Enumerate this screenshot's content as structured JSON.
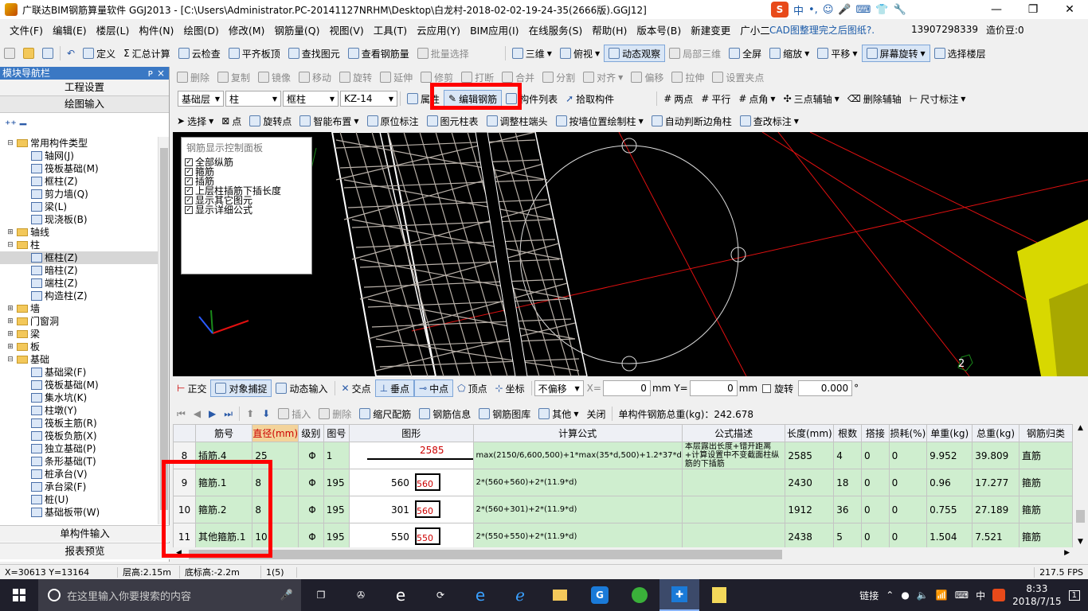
{
  "window": {
    "title": "广联达BIM钢筋算量软件 GGJ2013 - [C:\\Users\\Administrator.PC-20141127NRHM\\Desktop\\白龙村-2018-02-02-19-24-35(2666版).GGJ12]",
    "minimize": "—",
    "restore": "❐",
    "close": "✕"
  },
  "ime": {
    "brand": "S",
    "lang": "中",
    "punct": "•,",
    "emoji": "☺",
    "mic": "🎤",
    "keyboard": "⌨",
    "shirt": "👕",
    "tools": "🔧"
  },
  "menu": {
    "items": [
      "文件(F)",
      "编辑(E)",
      "楼层(L)",
      "构件(N)",
      "绘图(D)",
      "修改(M)",
      "钢筋量(Q)",
      "视图(V)",
      "工具(T)",
      "云应用(Y)",
      "BIM应用(I)",
      "在线服务(S)",
      "帮助(H)",
      "版本号(B)",
      "新建变更",
      "广小二"
    ],
    "cad_note": "CAD图整理完之后图纸?.",
    "phone": "13907298339",
    "cost_bean": "造价豆:0"
  },
  "toolbar1": {
    "define": "定义",
    "sum": "汇总计算",
    "cloud_check": "云检查",
    "flat_top": "平齐板顶",
    "find": "查找图元",
    "view_rebar": "查看钢筋量",
    "batch_select": "批量选择",
    "three_d": "三维",
    "top_view": "俯视",
    "dynamic": "动态观察",
    "local_3d": "局部三维",
    "fullscreen": "全屏",
    "zoom": "缩放",
    "pan": "平移",
    "rotate": "屏幕旋转",
    "select_floor": "选择楼层"
  },
  "toolbar2": {
    "delete": "删除",
    "copy": "复制",
    "mirror": "镜像",
    "move": "移动",
    "rotate": "旋转",
    "extend": "延伸",
    "trim": "修剪",
    "break": "打断",
    "merge": "合并",
    "split": "分割",
    "align": "对齐",
    "offset": "偏移",
    "stretch": "拉伸",
    "set_point": "设置夹点"
  },
  "toolbar3": {
    "floor": "基础层",
    "type": "柱",
    "subtype": "框柱",
    "component": "KZ-14",
    "property": "属性",
    "edit_rebar": "编辑钢筋",
    "comp_list": "构件列表",
    "pick": "拾取构件",
    "two_point": "两点",
    "parallel": "平行",
    "point_angle": "点角",
    "three_point_aux": "三点辅轴",
    "del_aux": "删除辅轴",
    "dim": "尺寸标注"
  },
  "toolbar4": {
    "select": "选择",
    "point": "点",
    "rotate_point": "旋转点",
    "smart_layout": "智能布置",
    "inplace_mark": "原位标注",
    "col_table": "图元柱表",
    "adjust_end": "调整柱端头",
    "draw_by_wall": "按墙位置绘制柱",
    "auto_corner": "自动判断边角柱",
    "check_mark": "查改标注"
  },
  "nav": {
    "title": "模块导航栏",
    "pin": "ᴘ",
    "close": "×",
    "project_settings": "工程设置",
    "drawing_input": "绘图输入",
    "single_input": "单构件输入",
    "report": "报表预览",
    "tree": [
      {
        "label": "常用构件类型",
        "level": 0,
        "type": "folder",
        "exp": "⊟"
      },
      {
        "label": "轴网(J)",
        "level": 1,
        "type": "leaf"
      },
      {
        "label": "筏板基础(M)",
        "level": 1,
        "type": "leaf"
      },
      {
        "label": "框柱(Z)",
        "level": 1,
        "type": "leaf"
      },
      {
        "label": "剪力墙(Q)",
        "level": 1,
        "type": "leaf"
      },
      {
        "label": "梁(L)",
        "level": 1,
        "type": "leaf"
      },
      {
        "label": "现浇板(B)",
        "level": 1,
        "type": "leaf"
      },
      {
        "label": "轴线",
        "level": 0,
        "type": "folder",
        "exp": "⊞"
      },
      {
        "label": "柱",
        "level": 0,
        "type": "folder",
        "exp": "⊟"
      },
      {
        "label": "框柱(Z)",
        "level": 1,
        "type": "leaf",
        "selected": true
      },
      {
        "label": "暗柱(Z)",
        "level": 1,
        "type": "leaf"
      },
      {
        "label": "端柱(Z)",
        "level": 1,
        "type": "leaf"
      },
      {
        "label": "构造柱(Z)",
        "level": 1,
        "type": "leaf"
      },
      {
        "label": "墙",
        "level": 0,
        "type": "folder",
        "exp": "⊞"
      },
      {
        "label": "门窗洞",
        "level": 0,
        "type": "folder",
        "exp": "⊞"
      },
      {
        "label": "梁",
        "level": 0,
        "type": "folder",
        "exp": "⊞"
      },
      {
        "label": "板",
        "level": 0,
        "type": "folder",
        "exp": "⊞"
      },
      {
        "label": "基础",
        "level": 0,
        "type": "folder",
        "exp": "⊟"
      },
      {
        "label": "基础梁(F)",
        "level": 1,
        "type": "leaf"
      },
      {
        "label": "筏板基础(M)",
        "level": 1,
        "type": "leaf"
      },
      {
        "label": "集水坑(K)",
        "level": 1,
        "type": "leaf"
      },
      {
        "label": "柱墩(Y)",
        "level": 1,
        "type": "leaf"
      },
      {
        "label": "筏板主筋(R)",
        "level": 1,
        "type": "leaf"
      },
      {
        "label": "筏板负筋(X)",
        "level": 1,
        "type": "leaf"
      },
      {
        "label": "独立基础(P)",
        "level": 1,
        "type": "leaf"
      },
      {
        "label": "条形基础(T)",
        "level": 1,
        "type": "leaf"
      },
      {
        "label": "桩承台(V)",
        "level": 1,
        "type": "leaf"
      },
      {
        "label": "承台梁(F)",
        "level": 1,
        "type": "leaf"
      },
      {
        "label": "桩(U)",
        "level": 1,
        "type": "leaf"
      },
      {
        "label": "基础板带(W)",
        "level": 1,
        "type": "leaf"
      }
    ]
  },
  "control_panel": {
    "title": "钢筋显示控制面板",
    "options": [
      "全部纵筋",
      "箍筋",
      "插筋",
      "上层柱插筋下插长度",
      "显示其它图元",
      "显示详细公式"
    ]
  },
  "viewport": {
    "badge": "2"
  },
  "snapbar": {
    "ortho": "正交",
    "osnap": "对象捕捉",
    "dyn_input": "动态输入",
    "intersect": "交点",
    "perp": "垂点",
    "mid": "中点",
    "vertex": "顶点",
    "coord": "坐标",
    "no_offset": "不偏移",
    "x_label": "X=",
    "x_val": "0",
    "mm1": "mm",
    "y_label": "Y=",
    "y_val": "0",
    "mm2": "mm",
    "rotate": "旋转",
    "rot_val": "0.000",
    "deg": "°"
  },
  "grid_toolbar": {
    "insert": "插入",
    "delete": "删除",
    "scale_rebar": "缩尺配筋",
    "rebar_info": "钢筋信息",
    "rebar_lib": "钢筋图库",
    "other": "其他",
    "close": "关闭",
    "total_label": "单构件钢筋总重(kg)：242.678"
  },
  "grid": {
    "columns": [
      "",
      "筋号",
      "直径(mm)",
      "级别",
      "图号",
      "图形",
      "计算公式",
      "公式描述",
      "长度(mm)",
      "根数",
      "搭接",
      "损耗(%)",
      "单重(kg)",
      "总重(kg)",
      "钢筋归类"
    ],
    "rows": [
      {
        "idx": "8",
        "name": "插筋.4",
        "dia": "25",
        "grade": "Φ",
        "fig": "1",
        "shape_a": "2585",
        "shape_b": "",
        "formula": "max(2150/6,600,500)+1*max(35*d,500)+1.2*37*d",
        "desc": "本层露出长度+错开距离+计算设置中不变截面柱纵筋的下插筋",
        "len": "2585",
        "count": "4",
        "lap": "0",
        "loss": "0",
        "unit_w": "9.952",
        "total_w": "39.809",
        "cat": "直筋"
      },
      {
        "idx": "9",
        "name": "箍筋.1",
        "dia": "8",
        "grade": "Φ",
        "fig": "195",
        "shape_a": "560",
        "shape_b": "560",
        "formula": "2*(560+560)+2*(11.9*d)",
        "desc": "",
        "len": "2430",
        "count": "18",
        "lap": "0",
        "loss": "0",
        "unit_w": "0.96",
        "total_w": "17.277",
        "cat": "箍筋"
      },
      {
        "idx": "10",
        "name": "箍筋.2",
        "dia": "8",
        "grade": "Φ",
        "fig": "195",
        "shape_a": "301",
        "shape_b": "560",
        "formula": "2*(560+301)+2*(11.9*d)",
        "desc": "",
        "len": "1912",
        "count": "36",
        "lap": "0",
        "loss": "0",
        "unit_w": "0.755",
        "total_w": "27.189",
        "cat": "箍筋"
      },
      {
        "idx": "11",
        "name": "其他箍筋.1",
        "dia": "10",
        "grade": "Φ",
        "fig": "195",
        "shape_a": "550",
        "shape_b": "550",
        "formula": "2*(550+550)+2*(11.9*d)",
        "desc": "",
        "len": "2438",
        "count": "5",
        "lap": "0",
        "loss": "0",
        "unit_w": "1.504",
        "total_w": "7.521",
        "cat": "箍筋"
      }
    ]
  },
  "status": {
    "coords": "X=30613 Y=13164",
    "floor_h": "层高:2.15m",
    "base_h": "底标高:-2.2m",
    "count": "1(5)",
    "fps": "217.5 FPS"
  },
  "taskbar": {
    "search": "在这里输入你要搜索的内容",
    "tray_link": "链接",
    "lang": "中",
    "time": "8:33",
    "date": "2018/7/15",
    "notify": "1"
  },
  "colors": {
    "row_bg": "#cfeecf",
    "highlight": "#ff0000",
    "viewport_bg": "#000000",
    "rebar": "#b8b0a8"
  }
}
